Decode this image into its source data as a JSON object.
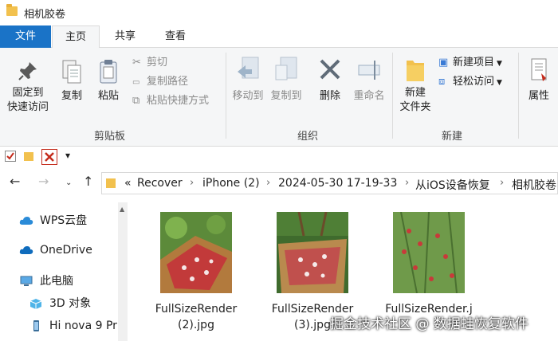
{
  "window": {
    "title": "相机胶卷"
  },
  "tabs": [
    {
      "label": "文件"
    },
    {
      "label": "主页"
    },
    {
      "label": "共享"
    },
    {
      "label": "查看"
    }
  ],
  "ribbon": {
    "clipboard": {
      "pin_line1": "固定到",
      "pin_line2": "快速访问",
      "copy": "复制",
      "paste": "粘贴",
      "cut": "剪切",
      "copy_path": "复制路径",
      "paste_shortcut": "粘贴快捷方式",
      "group_label": "剪贴板"
    },
    "organize": {
      "move_to": "移动到",
      "copy_to": "复制到",
      "delete": "删除",
      "rename": "重命名",
      "group_label": "组织"
    },
    "new": {
      "new_folder_line1": "新建",
      "new_folder_line2": "文件夹",
      "new_item": "新建项目",
      "easy_access": "轻松访问",
      "group_label": "新建"
    },
    "open": {
      "properties": "属性"
    }
  },
  "quick_access": {
    "dropdown": "▾"
  },
  "address": {
    "prefix": "«",
    "crumbs": [
      "Recover",
      "iPhone (2)",
      "2024-05-30 17-19-33",
      "从iOS设备恢复",
      "相机胶卷"
    ]
  },
  "sidebar": {
    "items": [
      {
        "label": "WPS云盘",
        "icon": "cloud-icon"
      },
      {
        "label": "OneDrive",
        "icon": "onedrive-icon"
      },
      {
        "label": "此电脑",
        "icon": "computer-icon"
      },
      {
        "label": "3D 对象",
        "icon": "3d-objects-icon"
      },
      {
        "label": "Hi nova 9 Pr",
        "icon": "phone-icon"
      }
    ]
  },
  "files": [
    {
      "line1": "FullSizeRender",
      "line2": "(2).jpg"
    },
    {
      "line1": "FullSizeRender",
      "line2": "(3).jpg"
    },
    {
      "line1": "FullSizeRender.j",
      "line2": ""
    }
  ],
  "watermark": {
    "text": "掘金技术社区 @ 数据蛙恢复软件"
  },
  "colors": {
    "accent": "#1a73c7",
    "folder": "#f2c14e",
    "delete": "#c42b1c"
  }
}
